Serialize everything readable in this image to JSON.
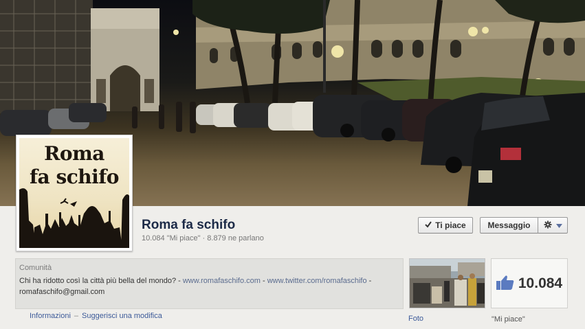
{
  "page": {
    "title": "Roma fa schifo",
    "likes_stat": "10.084 \"Mi piace\"",
    "stats_separator": " · ",
    "talking_stat": "8.879 ne parlano"
  },
  "profile": {
    "logo_line1": "Roma",
    "logo_line2": "fa schifo"
  },
  "actions": {
    "like_label": "Ti piace",
    "message_label": "Messaggio"
  },
  "about": {
    "category": "Comunità",
    "description_text": "Chi ha ridotto così la città più bella del mondo? - ",
    "link1": "www.romafaschifo.com",
    "dash1": " - ",
    "link2": "www.twitter.com/romafaschifo",
    "dash2": " -",
    "email": "romafaschifo@gmail.com"
  },
  "links": {
    "info": "Informazioni",
    "separator": "–",
    "suggest": "Suggerisci una modifica"
  },
  "photos": {
    "label": "Foto"
  },
  "likes_box": {
    "count": "10.084",
    "label": "\"Mi piace\""
  },
  "icons": {
    "check": "check-icon",
    "gear": "gear-icon",
    "dropdown": "chevron-down-icon",
    "thumb": "thumbs-up-icon"
  },
  "colors": {
    "title": "#1c2a47",
    "link": "#3b5998",
    "thumb": "#5b7bc0"
  }
}
